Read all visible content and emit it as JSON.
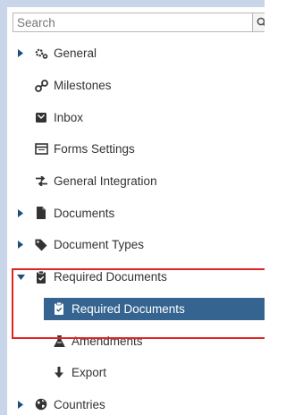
{
  "search": {
    "placeholder": "Search"
  },
  "tree": {
    "items": [
      {
        "label": "General",
        "icon": "cogs-icon",
        "expandable": true,
        "expanded": false
      },
      {
        "label": "Milestones",
        "icon": "milestones-icon",
        "expandable": false
      },
      {
        "label": "Inbox",
        "icon": "inbox-icon",
        "expandable": false
      },
      {
        "label": "Forms Settings",
        "icon": "forms-icon",
        "expandable": false
      },
      {
        "label": "General Integration",
        "icon": "integration-icon",
        "expandable": false
      },
      {
        "label": "Documents",
        "icon": "document-icon",
        "expandable": true,
        "expanded": false
      },
      {
        "label": "Document Types",
        "icon": "tag-icon",
        "expandable": true,
        "expanded": false
      },
      {
        "label": "Required Documents",
        "icon": "clipboard-icon",
        "expandable": true,
        "expanded": true
      },
      {
        "label": "Required Documents",
        "icon": "clipboard-icon",
        "selected": true
      },
      {
        "label": "Amendments",
        "icon": "flask-icon"
      },
      {
        "label": "Export",
        "icon": "arrow-down-icon"
      },
      {
        "label": "Countries",
        "icon": "globe-icon",
        "expandable": true,
        "expanded": false
      }
    ]
  },
  "colors": {
    "selected_background": "#34648f",
    "icon": "#333333",
    "frame": "#c9d5e8",
    "highlight": "#e02424"
  }
}
